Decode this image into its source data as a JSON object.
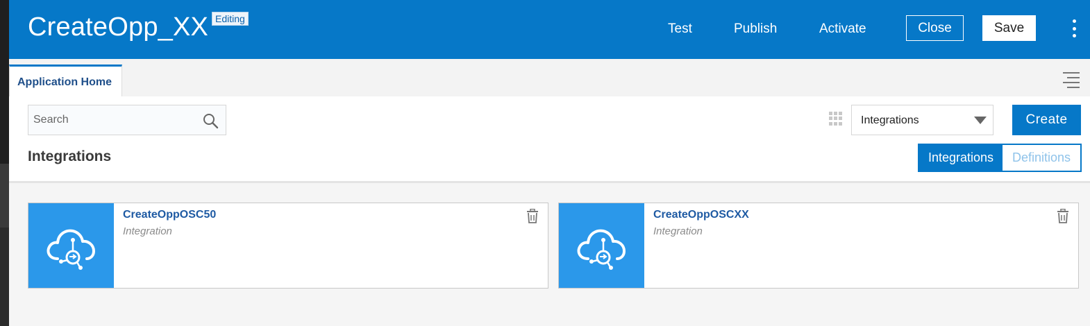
{
  "header": {
    "title": "CreateOpp_XX",
    "badge": "Editing",
    "links": {
      "test": "Test",
      "publish": "Publish",
      "activate": "Activate"
    },
    "close_label": "Close",
    "save_label": "Save"
  },
  "tabs": {
    "active": "Application Home"
  },
  "toolbar": {
    "search_placeholder": "Search",
    "type_select": "Integrations",
    "create_label": "Create"
  },
  "section": {
    "title": "Integrations",
    "toggle": {
      "on": "Integrations",
      "off": "Definitions"
    }
  },
  "cards": [
    {
      "name": "CreateOppOSC50",
      "type": "Integration"
    },
    {
      "name": "CreateOppOSCXX",
      "type": "Integration"
    }
  ],
  "colors": {
    "brand": "#0678c8",
    "thumb": "#2b98ea",
    "link": "#1e5aa3"
  }
}
